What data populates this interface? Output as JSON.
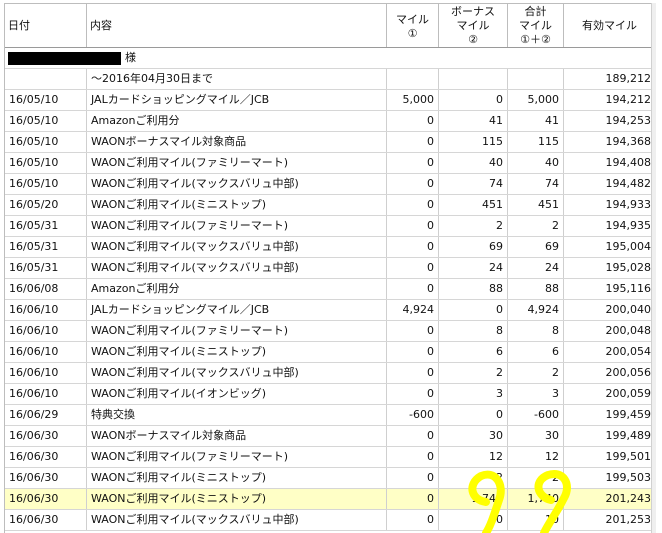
{
  "header": {
    "date": "日付",
    "desc": "内容",
    "mile": [
      "マイル",
      "①"
    ],
    "bonus": [
      "ボーナス",
      "マイル",
      "②"
    ],
    "total": [
      "合計",
      "マイル",
      "①＋②"
    ],
    "effective": "有効マイル"
  },
  "name_suffix": "様",
  "opening": {
    "desc": "～2016年04月30日まで",
    "effective": "189,212"
  },
  "rows": [
    {
      "date": "16/05/10",
      "desc": "JALカードショッピングマイル／JCB",
      "mile": "5,000",
      "bonus": "0",
      "total": "5,000",
      "effective": "194,212"
    },
    {
      "date": "16/05/10",
      "desc": "Amazonご利用分",
      "mile": "0",
      "bonus": "41",
      "total": "41",
      "effective": "194,253"
    },
    {
      "date": "16/05/10",
      "desc": "WAONボーナスマイル対象商品",
      "mile": "0",
      "bonus": "115",
      "total": "115",
      "effective": "194,368"
    },
    {
      "date": "16/05/10",
      "desc": "WAONご利用マイル(ファミリーマート)",
      "mile": "0",
      "bonus": "40",
      "total": "40",
      "effective": "194,408"
    },
    {
      "date": "16/05/10",
      "desc": "WAONご利用マイル(マックスバリュ中部)",
      "mile": "0",
      "bonus": "74",
      "total": "74",
      "effective": "194,482"
    },
    {
      "date": "16/05/20",
      "desc": "WAONご利用マイル(ミニストップ)",
      "mile": "0",
      "bonus": "451",
      "total": "451",
      "effective": "194,933"
    },
    {
      "date": "16/05/31",
      "desc": "WAONご利用マイル(ファミリーマート)",
      "mile": "0",
      "bonus": "2",
      "total": "2",
      "effective": "194,935"
    },
    {
      "date": "16/05/31",
      "desc": "WAONご利用マイル(マックスバリュ中部)",
      "mile": "0",
      "bonus": "69",
      "total": "69",
      "effective": "195,004"
    },
    {
      "date": "16/05/31",
      "desc": "WAONご利用マイル(マックスバリュ中部)",
      "mile": "0",
      "bonus": "24",
      "total": "24",
      "effective": "195,028"
    },
    {
      "date": "16/06/08",
      "desc": "Amazonご利用分",
      "mile": "0",
      "bonus": "88",
      "total": "88",
      "effective": "195,116"
    },
    {
      "date": "16/06/10",
      "desc": "JALカードショッピングマイル／JCB",
      "mile": "4,924",
      "bonus": "0",
      "total": "4,924",
      "effective": "200,040"
    },
    {
      "date": "16/06/10",
      "desc": "WAONご利用マイル(ファミリーマート)",
      "mile": "0",
      "bonus": "8",
      "total": "8",
      "effective": "200,048"
    },
    {
      "date": "16/06/10",
      "desc": "WAONご利用マイル(ミニストップ)",
      "mile": "0",
      "bonus": "6",
      "total": "6",
      "effective": "200,054"
    },
    {
      "date": "16/06/10",
      "desc": "WAONご利用マイル(マックスバリュ中部)",
      "mile": "0",
      "bonus": "2",
      "total": "2",
      "effective": "200,056"
    },
    {
      "date": "16/06/10",
      "desc": "WAONご利用マイル(イオンビッグ)",
      "mile": "0",
      "bonus": "3",
      "total": "3",
      "effective": "200,059"
    },
    {
      "date": "16/06/29",
      "desc": "特典交換",
      "mile": "-600",
      "bonus": "0",
      "total": "-600",
      "effective": "199,459"
    },
    {
      "date": "16/06/30",
      "desc": "WAONボーナスマイル対象商品",
      "mile": "0",
      "bonus": "30",
      "total": "30",
      "effective": "199,489"
    },
    {
      "date": "16/06/30",
      "desc": "WAONご利用マイル(ファミリーマート)",
      "mile": "0",
      "bonus": "12",
      "total": "12",
      "effective": "199,501"
    },
    {
      "date": "16/06/30",
      "desc": "WAONご利用マイル(ミニストップ)",
      "mile": "0",
      "bonus": "2",
      "total": "2",
      "effective": "199,503"
    },
    {
      "date": "16/06/30",
      "desc": "WAONご利用マイル(ミニストップ)",
      "mile": "0",
      "bonus": "1,740",
      "total": "1,740",
      "effective": "201,243",
      "highlight": true
    },
    {
      "date": "16/06/30",
      "desc": "WAONご利用マイル(マックスバリュ中部)",
      "mile": "0",
      "bonus": "10",
      "total": "10",
      "effective": "201,253"
    }
  ],
  "colors": {
    "highlight_row": "#ffffc6",
    "annotation_marker": "#ffff00",
    "redaction": "#000000"
  }
}
